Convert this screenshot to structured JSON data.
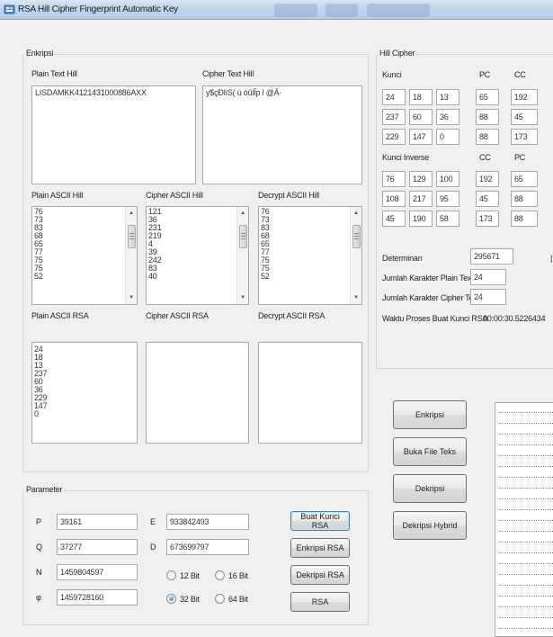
{
  "window": {
    "title": "RSA Hill Cipher Fingerprint Automatic Key"
  },
  "enkripsi": {
    "group_label": "Enkripsi",
    "plain_text_label": "Plain Text Hill",
    "plain_text_value": "LISDAMKK4121431000886AXX",
    "cipher_text_label": "Cipher Text Hill",
    "cipher_text_value": "y$çÐlìS( ú óûlÎp l @Ä·",
    "plain_ascii_hill_label": "Plain ASCII Hill",
    "plain_ascii_hill": [
      "76",
      "73",
      "83",
      "68",
      "65",
      "77",
      "75",
      "75",
      "52"
    ],
    "cipher_ascii_hill_label": "Cipher ASCII Hill",
    "cipher_ascii_hill": [
      "121",
      "36",
      "231",
      "219",
      "4",
      "39",
      "242",
      "83",
      "40"
    ],
    "decrypt_ascii_hill_label": "Decrypt ASCII Hill",
    "decrypt_ascii_hill": [
      "76",
      "73",
      "83",
      "68",
      "65",
      "77",
      "75",
      "75",
      "52"
    ],
    "plain_ascii_rsa_label": "Plain ASCII RSA",
    "plain_ascii_rsa": [
      "24",
      "18",
      "13",
      "237",
      "60",
      "36",
      "229",
      "147",
      "0"
    ],
    "cipher_ascii_rsa_label": "Cipher ASCII RSA",
    "decrypt_ascii_rsa_label": "Decrypt ASCII RSA"
  },
  "hill": {
    "group_label": "Hill Cipher",
    "kunci_label": "Kunci",
    "pc_label": "PC",
    "cc_label": "CC",
    "kunci": [
      [
        "24",
        "18",
        "13"
      ],
      [
        "237",
        "60",
        "36"
      ],
      [
        "229",
        "147",
        "0"
      ]
    ],
    "pc": [
      "65",
      "88",
      "88"
    ],
    "cc": [
      "192",
      "45",
      "173"
    ],
    "kunci_inverse_label": "Kunci Inverse",
    "cc2_label": "CC",
    "pc2_label": "PC",
    "kunci_inverse": [
      [
        "76",
        "129",
        "100"
      ],
      [
        "108",
        "217",
        "95"
      ],
      [
        "45",
        "190",
        "58"
      ]
    ],
    "cc2": [
      "192",
      "45",
      "173"
    ],
    "pc2": [
      "65",
      "88",
      "88"
    ],
    "determinan_label": "Determinan",
    "determinan_value": "295671",
    "jumlah_plain_label": "Jumlah Karakter Plain Text",
    "jumlah_plain_value": "24",
    "jumlah_cipher_label": "Jumlah Karakter Cipher Text",
    "jumlah_cipher_value": "24",
    "waktu_label": "Waktu Proses Buat Kunci RSA",
    "waktu_value": "00:00:30.5226434"
  },
  "actions": {
    "enkripsi": "Enkripsi",
    "buka_file": "Buka File Teks",
    "dekripsi": "Dekripsi",
    "dekripsi_hybrid": "Dekripsi Hybrid"
  },
  "parameter": {
    "group_label": "Parameter",
    "p_label": "P",
    "p_value": "39161",
    "q_label": "Q",
    "q_value": "37277",
    "n_label": "N",
    "n_value": "1459804597",
    "phi_label": "φ",
    "phi_value": "1459728160",
    "e_label": "E",
    "e_value": "933842493",
    "d_label": "D",
    "d_value": "673699797",
    "bit_options": [
      "12 Bit",
      "16 Bit",
      "32 Bit",
      "64 Bit"
    ],
    "selected_bit": "32 Bit",
    "btn_buat_kunci": "Buat Kunci RSA",
    "btn_enkripsi_rsa": "Enkripsi RSA",
    "btn_dekripsi_rsa": "Dekripsi RSA",
    "btn_rsa": "RSA"
  },
  "colors": {
    "titlebar": "#c2d6ee",
    "radio_selected": "#1669b6",
    "focus_border": "#3c7fb1"
  }
}
